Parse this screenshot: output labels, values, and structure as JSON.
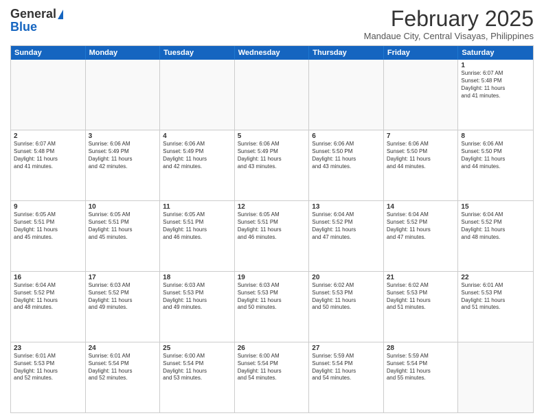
{
  "logo": {
    "line1": "General",
    "line2": "Blue"
  },
  "header": {
    "month": "February 2025",
    "location": "Mandaue City, Central Visayas, Philippines"
  },
  "weekdays": [
    "Sunday",
    "Monday",
    "Tuesday",
    "Wednesday",
    "Thursday",
    "Friday",
    "Saturday"
  ],
  "weeks": [
    [
      {
        "day": "",
        "info": ""
      },
      {
        "day": "",
        "info": ""
      },
      {
        "day": "",
        "info": ""
      },
      {
        "day": "",
        "info": ""
      },
      {
        "day": "",
        "info": ""
      },
      {
        "day": "",
        "info": ""
      },
      {
        "day": "1",
        "info": "Sunrise: 6:07 AM\nSunset: 5:48 PM\nDaylight: 11 hours\nand 41 minutes."
      }
    ],
    [
      {
        "day": "2",
        "info": "Sunrise: 6:07 AM\nSunset: 5:48 PM\nDaylight: 11 hours\nand 41 minutes."
      },
      {
        "day": "3",
        "info": "Sunrise: 6:06 AM\nSunset: 5:49 PM\nDaylight: 11 hours\nand 42 minutes."
      },
      {
        "day": "4",
        "info": "Sunrise: 6:06 AM\nSunset: 5:49 PM\nDaylight: 11 hours\nand 42 minutes."
      },
      {
        "day": "5",
        "info": "Sunrise: 6:06 AM\nSunset: 5:49 PM\nDaylight: 11 hours\nand 43 minutes."
      },
      {
        "day": "6",
        "info": "Sunrise: 6:06 AM\nSunset: 5:50 PM\nDaylight: 11 hours\nand 43 minutes."
      },
      {
        "day": "7",
        "info": "Sunrise: 6:06 AM\nSunset: 5:50 PM\nDaylight: 11 hours\nand 44 minutes."
      },
      {
        "day": "8",
        "info": "Sunrise: 6:06 AM\nSunset: 5:50 PM\nDaylight: 11 hours\nand 44 minutes."
      }
    ],
    [
      {
        "day": "9",
        "info": "Sunrise: 6:05 AM\nSunset: 5:51 PM\nDaylight: 11 hours\nand 45 minutes."
      },
      {
        "day": "10",
        "info": "Sunrise: 6:05 AM\nSunset: 5:51 PM\nDaylight: 11 hours\nand 45 minutes."
      },
      {
        "day": "11",
        "info": "Sunrise: 6:05 AM\nSunset: 5:51 PM\nDaylight: 11 hours\nand 46 minutes."
      },
      {
        "day": "12",
        "info": "Sunrise: 6:05 AM\nSunset: 5:51 PM\nDaylight: 11 hours\nand 46 minutes."
      },
      {
        "day": "13",
        "info": "Sunrise: 6:04 AM\nSunset: 5:52 PM\nDaylight: 11 hours\nand 47 minutes."
      },
      {
        "day": "14",
        "info": "Sunrise: 6:04 AM\nSunset: 5:52 PM\nDaylight: 11 hours\nand 47 minutes."
      },
      {
        "day": "15",
        "info": "Sunrise: 6:04 AM\nSunset: 5:52 PM\nDaylight: 11 hours\nand 48 minutes."
      }
    ],
    [
      {
        "day": "16",
        "info": "Sunrise: 6:04 AM\nSunset: 5:52 PM\nDaylight: 11 hours\nand 48 minutes."
      },
      {
        "day": "17",
        "info": "Sunrise: 6:03 AM\nSunset: 5:52 PM\nDaylight: 11 hours\nand 49 minutes."
      },
      {
        "day": "18",
        "info": "Sunrise: 6:03 AM\nSunset: 5:53 PM\nDaylight: 11 hours\nand 49 minutes."
      },
      {
        "day": "19",
        "info": "Sunrise: 6:03 AM\nSunset: 5:53 PM\nDaylight: 11 hours\nand 50 minutes."
      },
      {
        "day": "20",
        "info": "Sunrise: 6:02 AM\nSunset: 5:53 PM\nDaylight: 11 hours\nand 50 minutes."
      },
      {
        "day": "21",
        "info": "Sunrise: 6:02 AM\nSunset: 5:53 PM\nDaylight: 11 hours\nand 51 minutes."
      },
      {
        "day": "22",
        "info": "Sunrise: 6:01 AM\nSunset: 5:53 PM\nDaylight: 11 hours\nand 51 minutes."
      }
    ],
    [
      {
        "day": "23",
        "info": "Sunrise: 6:01 AM\nSunset: 5:53 PM\nDaylight: 11 hours\nand 52 minutes."
      },
      {
        "day": "24",
        "info": "Sunrise: 6:01 AM\nSunset: 5:54 PM\nDaylight: 11 hours\nand 52 minutes."
      },
      {
        "day": "25",
        "info": "Sunrise: 6:00 AM\nSunset: 5:54 PM\nDaylight: 11 hours\nand 53 minutes."
      },
      {
        "day": "26",
        "info": "Sunrise: 6:00 AM\nSunset: 5:54 PM\nDaylight: 11 hours\nand 54 minutes."
      },
      {
        "day": "27",
        "info": "Sunrise: 5:59 AM\nSunset: 5:54 PM\nDaylight: 11 hours\nand 54 minutes."
      },
      {
        "day": "28",
        "info": "Sunrise: 5:59 AM\nSunset: 5:54 PM\nDaylight: 11 hours\nand 55 minutes."
      },
      {
        "day": "",
        "info": ""
      }
    ]
  ]
}
